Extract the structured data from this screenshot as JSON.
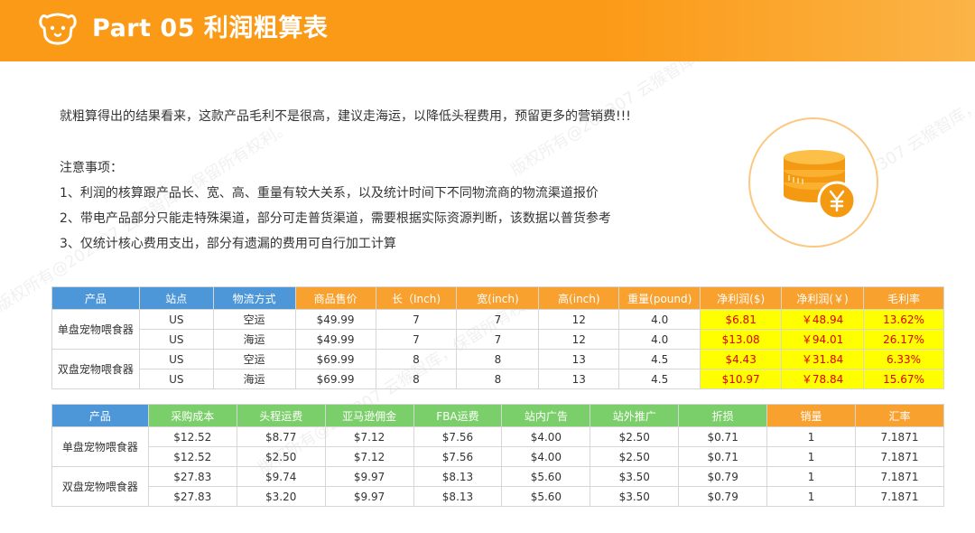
{
  "header": {
    "title": "Part 05 利润粗算表"
  },
  "intro": "就粗算得出的结果看来，这款产品毛利不是很高，建议走海运，以降低头程费用，预留更多的营销费!!!",
  "notes": {
    "title": "注意事项：",
    "items": [
      "1、利润的核算跟产品长、宽、高、重量有较大关系，以及统计时间下不同物流商的物流渠道报价",
      "2、带电产品部分只能走特殊渠道，部分可走普货渠道，需要根据实际资源判断，该数据以普货参考",
      "3、仅统计核心费用支出，部分有遗漏的费用可自行加工计算"
    ]
  },
  "watermark": "版权所有@202307 云猴智库，保留所有权利。",
  "table1": {
    "headers": [
      "产品",
      "站点",
      "物流方式",
      "商品售价",
      "长（Inch)",
      "宽(inch)",
      "高(inch)",
      "重量(pound)",
      "净利润($)",
      "净利润(￥)",
      "毛利率"
    ],
    "products": [
      "单盘宠物喂食器",
      "双盘宠物喂食器"
    ],
    "rows": [
      [
        "US",
        "空运",
        "$49.99",
        "7",
        "7",
        "12",
        "4.0",
        "$6.81",
        "￥48.94",
        "13.62%"
      ],
      [
        "US",
        "海运",
        "$49.99",
        "7",
        "7",
        "12",
        "4.0",
        "$13.08",
        "￥94.01",
        "26.17%"
      ],
      [
        "US",
        "空运",
        "$69.99",
        "8",
        "8",
        "13",
        "4.5",
        "$4.43",
        "￥31.84",
        "6.33%"
      ],
      [
        "US",
        "海运",
        "$69.99",
        "8",
        "8",
        "13",
        "4.5",
        "$10.97",
        "￥78.84",
        "15.67%"
      ]
    ]
  },
  "table2": {
    "headers": [
      "产品",
      "采购成本",
      "头程运费",
      "亚马逊佣金",
      "FBA运费",
      "站内广告",
      "站外推广",
      "折损",
      "销量",
      "汇率"
    ],
    "products": [
      "单盘宠物喂食器",
      "双盘宠物喂食器"
    ],
    "rows": [
      [
        "$12.52",
        "$8.77",
        "$7.12",
        "$7.56",
        "$4.00",
        "$2.50",
        "$0.71",
        "1",
        "7.1871"
      ],
      [
        "$12.52",
        "$2.50",
        "$7.12",
        "$7.56",
        "$4.00",
        "$2.50",
        "$0.71",
        "1",
        "7.1871"
      ],
      [
        "$27.83",
        "$9.74",
        "$9.97",
        "$8.13",
        "$5.60",
        "$3.50",
        "$0.79",
        "1",
        "7.1871"
      ],
      [
        "$27.83",
        "$3.20",
        "$9.97",
        "$8.13",
        "$5.60",
        "$3.50",
        "$0.79",
        "1",
        "7.1871"
      ]
    ]
  },
  "colors": {
    "header": "#fb9a17",
    "blue_header": "#4d97d9",
    "orange_header": "#f8a12e",
    "green_header": "#7bcf6a",
    "profit_highlight": "#ffff00",
    "profit_text": "#e00000"
  },
  "icons": {
    "logo": "dog-face-icon",
    "illustration": "coin-stack-yuan-icon"
  }
}
